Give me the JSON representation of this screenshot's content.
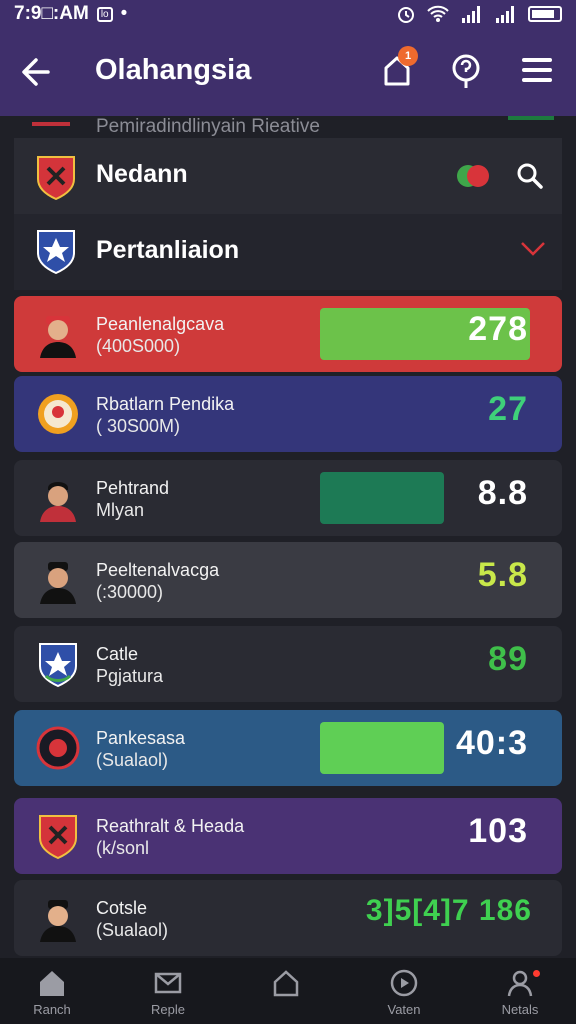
{
  "status": {
    "time": "7:9□:AM",
    "box": "lo",
    "dot": "•",
    "icons": [
      "alarm-icon",
      "wifi-icon",
      "signal-icon",
      "signal-icon",
      "battery-icon"
    ]
  },
  "header": {
    "title": "Olahangsia",
    "notification_count": "1"
  },
  "partial_row": {
    "label": "Pemiradindlinyain Rieative"
  },
  "sections": [
    {
      "label": "Nedann",
      "icon": "crest-shield-icon"
    },
    {
      "label": "Pertanliaion",
      "icon": "crest-star-icon"
    }
  ],
  "rows": [
    {
      "name": "Peanlenalgcava",
      "sub": "(400S000)",
      "value": "278",
      "bg": "#cf3a3a",
      "value_color": "#ffffff",
      "bar_color": "#6cc24a",
      "avatar": "avatar-player-icon"
    },
    {
      "name": "Rbatlarn Pendika",
      "sub": "( 30S00M)",
      "value": "27",
      "bg": "#34367a",
      "value_color": "#3fd07a",
      "bar_color": "",
      "avatar": "club-badge-icon"
    },
    {
      "name": "Pehtrand",
      "sub": "Mlyan",
      "value": "8.8",
      "bg": "#2a2b33",
      "value_color": "#ffffff",
      "bar_color": "#1d7a55",
      "avatar": "avatar-player-icon"
    },
    {
      "name": "Peeltenalvacga",
      "sub": "(:30000)",
      "value": "5.8",
      "bg": "#3a3b43",
      "value_color": "#c9e84a",
      "bar_color": "",
      "avatar": "avatar-player-icon"
    },
    {
      "name": "Catle",
      "sub": "Pgjatura",
      "value": "89",
      "bg": "#2a2b33",
      "value_color": "#3fbf4a",
      "bar_color": "",
      "avatar": "crest-star-icon"
    },
    {
      "name": "Pankesasa",
      "sub": "(Sualaol)",
      "value": "40:3",
      "bg": "#2c5a86",
      "value_color": "#ffffff",
      "bar_color": "#5fcf55",
      "avatar": "club-badge-icon"
    },
    {
      "name": "Reathralt & Heada",
      "sub": "(k/sonl",
      "value": "103",
      "bg": "#4a3274",
      "value_color": "#ffffff",
      "bar_color": "",
      "avatar": "crest-shield-icon"
    },
    {
      "name": "Cotsle",
      "sub": "(Sualaol)",
      "value": "3]5[4]7 186",
      "bg": "#2a2b33",
      "value_color": "#3fd050",
      "bar_color": "",
      "avatar": "avatar-player-icon"
    }
  ],
  "tabs": [
    {
      "label": "Ranch",
      "icon": "home-icon"
    },
    {
      "label": "Reple",
      "icon": "mail-icon"
    },
    {
      "label": "",
      "icon": "home-outline-icon"
    },
    {
      "label": "Vaten",
      "icon": "play-circle-icon"
    },
    {
      "label": "Netals",
      "icon": "profile-icon"
    }
  ],
  "colors": {
    "appbar": "#3f2f6b",
    "background": "#1f2027",
    "accent_orange": "#ef6a2e"
  }
}
